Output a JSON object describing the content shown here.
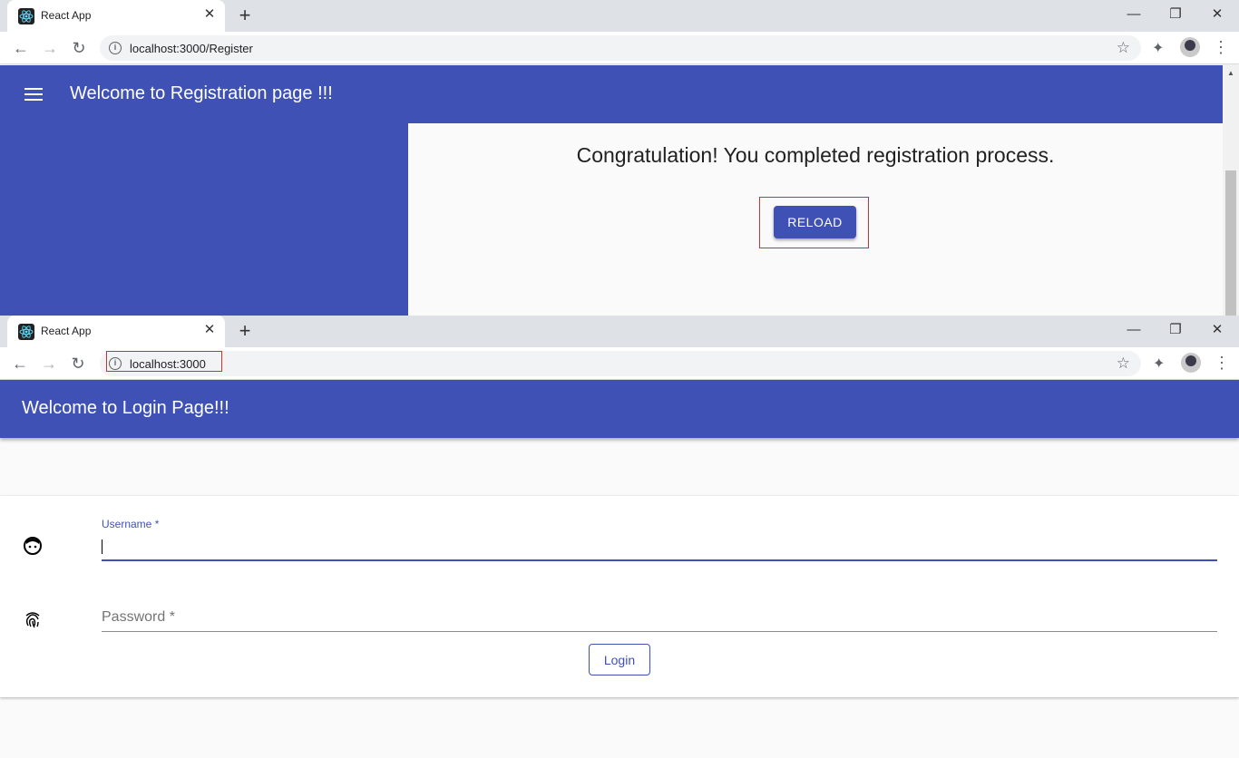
{
  "top_window": {
    "tab_title": "React App",
    "tab_close": "✕",
    "new_tab": "+",
    "url": "localhost:3000/Register",
    "appbar_title": "Welcome to Registration page !!!",
    "congrats_text": "Congratulation! You completed registration process.",
    "reload_label": "RELOAD"
  },
  "bottom_window": {
    "tab_title": "React App",
    "tab_close": "✕",
    "new_tab": "+",
    "url": "localhost:3000",
    "appbar_title": "Welcome to Login Page!!!",
    "username_label": "Username *",
    "username_value": "",
    "password_placeholder": "Password *",
    "login_label": "Login"
  },
  "colors": {
    "primary": "#3f51b5",
    "highlight": "#d32f2f"
  },
  "icons": [
    "react-icon",
    "back-icon",
    "forward-icon",
    "reload-icon",
    "info-icon",
    "star-icon",
    "extensions-icon",
    "profile-avatar",
    "menu-icon",
    "face-icon",
    "fingerprint-icon"
  ]
}
